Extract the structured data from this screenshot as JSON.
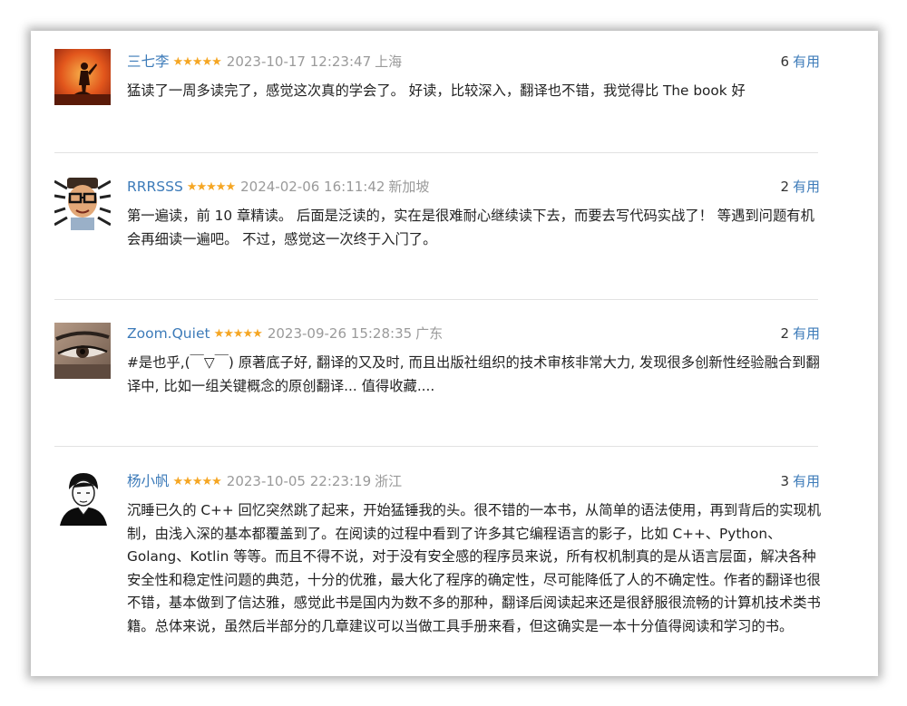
{
  "useful_label": "有用",
  "colors": {
    "author_link": "#3d7bb9",
    "star": "#f5a623",
    "meta": "#9a9a9a"
  },
  "reviews": [
    {
      "author": "三七李",
      "avatar_icon": "silhouette-sunset-icon",
      "stars": "★★★★★",
      "rating": 5,
      "time": "2023-10-17 12:23:47",
      "location": "上海",
      "useful_count": "6",
      "content": "猛读了一周多读完了，感觉这次真的学会了。 好读，比较深入，翻译也不错，我觉得比 The book 好"
    },
    {
      "author": "RRRSSS",
      "avatar_icon": "cartoon-face-glasses-icon",
      "stars": "★★★★★",
      "rating": 5,
      "time": "2024-02-06 16:11:42",
      "location": "新加坡",
      "useful_count": "2",
      "content": "第一遍读，前 10 章精读。 后面是泛读的，实在是很难耐心继续读下去，而要去写代码实战了！ 等遇到问题有机会再细读一遍吧。 不过，感觉这一次终于入门了。"
    },
    {
      "author": "Zoom.Quiet",
      "avatar_icon": "eye-closeup-icon",
      "stars": "★★★★★",
      "rating": 5,
      "time": "2023-09-26 15:28:35",
      "location": "广东",
      "useful_count": "2",
      "content": "#是也乎,(￣▽￣) 原著底子好, 翻译的又及时, 而且出版社组织的技术审核非常大力, 发现很多创新性经验融合到翻译中, 比如一组关键概念的原创翻译... 值得收藏...."
    },
    {
      "author": "杨小帆",
      "avatar_icon": "sketch-portrait-icon",
      "stars": "★★★★★",
      "rating": 5,
      "time": "2023-10-05 22:23:19",
      "location": "浙江",
      "useful_count": "3",
      "content": "沉睡已久的 C++ 回忆突然跳了起来，开始猛锤我的头。很不错的一本书，从简单的语法使用，再到背后的实现机制，由浅入深的基本都覆盖到了。在阅读的过程中看到了许多其它编程语言的影子，比如 C++、Python、Golang、Kotlin 等等。而且不得不说，对于没有安全感的程序员来说，所有权机制真的是从语言层面，解决各种安全性和稳定性问题的典范，十分的优雅，最大化了程序的确定性，尽可能降低了人的不确定性。作者的翻译也很不错，基本做到了信达雅，感觉此书是国内为数不多的那种，翻译后阅读起来还是很舒服很流畅的计算机技术类书籍。总体来说，虽然后半部分的几章建议可以当做工具手册来看，但这确实是一本十分值得阅读和学习的书。"
    }
  ]
}
